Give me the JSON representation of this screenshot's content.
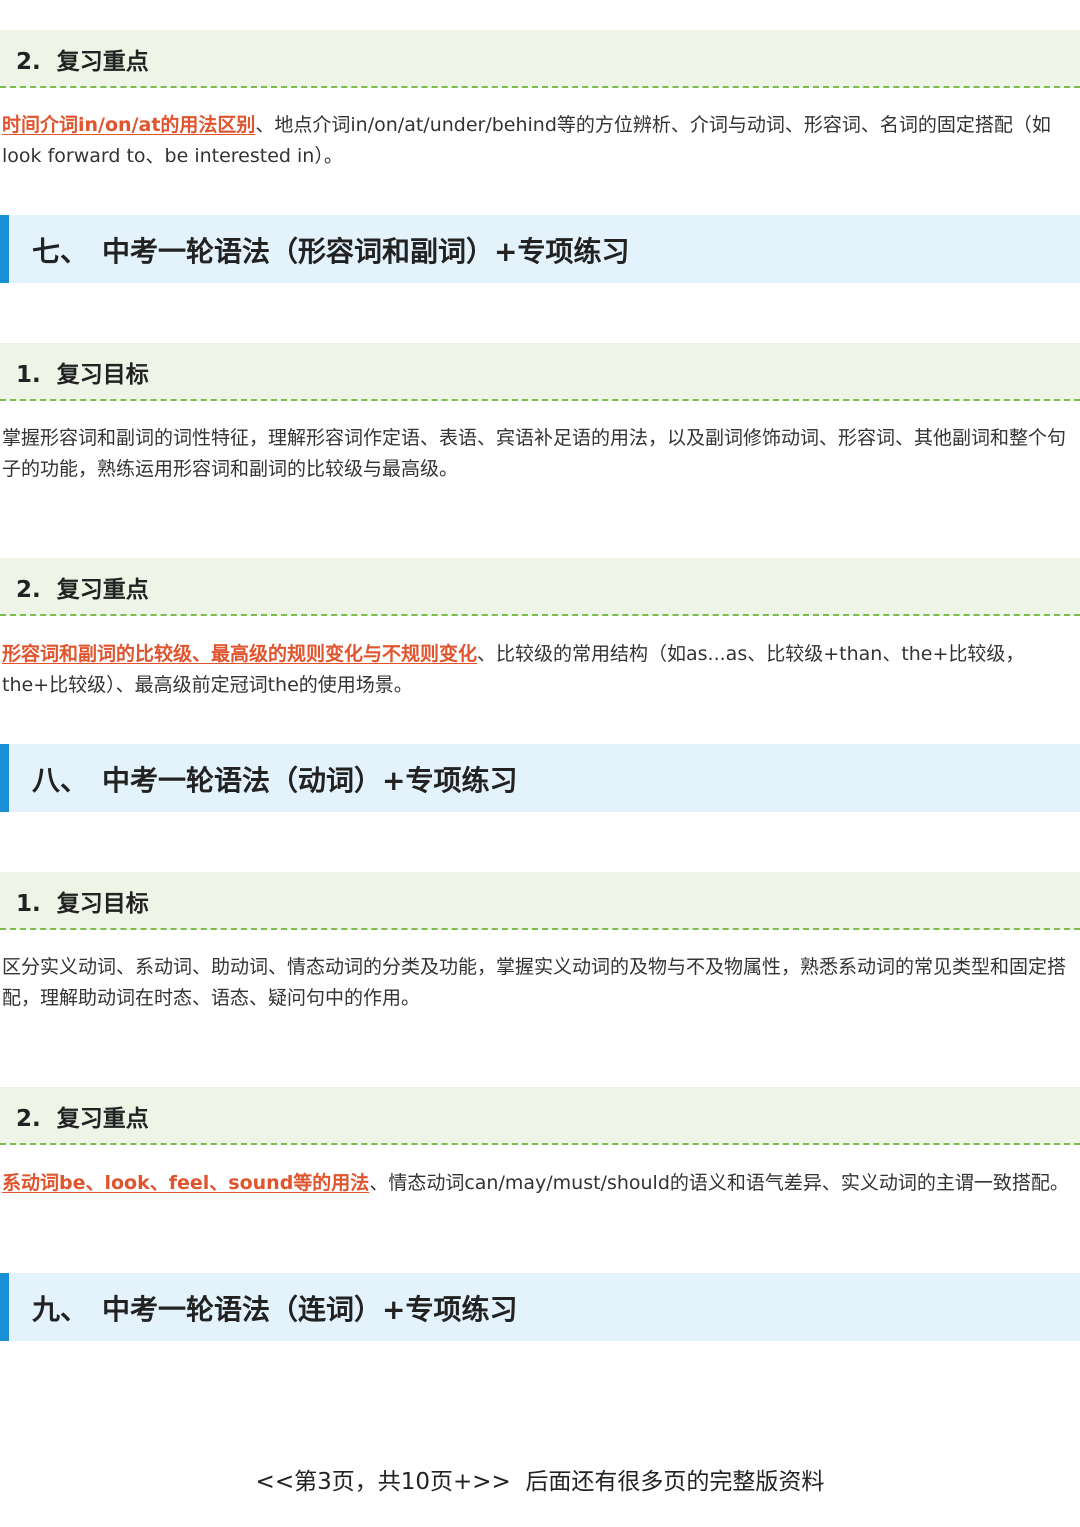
{
  "blocks": [
    {
      "sub1": {
        "number": "2.",
        "title": "复习重点"
      },
      "para1": {
        "highlight": "时间介词in/on/at的用法区别",
        "text": "、地点介词in/on/at/under/behind等的方位辨析、介词与动词、形容词、名词的固定搭配（如look forward to、be interested in）。"
      }
    }
  ],
  "sections": [
    {
      "number": "七、",
      "title": "中考一轮语法（形容词和副词）+专项练习",
      "goal_heading": {
        "number": "1.",
        "title": "复习目标"
      },
      "goal_text": "掌握形容词和副词的词性特征，理解形容词作定语、表语、宾语补足语的用法，以及副词修饰动词、形容词、其他副词和整个句子的功能，熟练运用形容词和副词的比较级与最高级。",
      "focus_heading": {
        "number": "2.",
        "title": "复习重点"
      },
      "focus_highlight": "形容词和副词的比较级、最高级的规则变化与不规则变化",
      "focus_text": "、比较级的常用结构（如as...as、比较级+than、the+比较级，the+比较级）、最高级前定冠词the的使用场景。"
    },
    {
      "number": "八、",
      "title": "中考一轮语法（动词）+专项练习",
      "goal_heading": {
        "number": "1.",
        "title": "复习目标"
      },
      "goal_text": "区分实义动词、系动词、助动词、情态动词的分类及功能，掌握实义动词的及物与不及物属性，熟悉系动词的常见类型和固定搭配，理解助动词在时态、语态、疑问句中的作用。",
      "focus_heading": {
        "number": "2.",
        "title": "复习重点"
      },
      "focus_highlight": "系动词be、look、feel、sound等的用法",
      "focus_text": "、情态动词can/may/must/should的语义和语气差异、实义动词的主谓一致搭配。"
    },
    {
      "number": "九、",
      "title": "中考一轮语法（连词）+专项练习"
    }
  ],
  "footer": {
    "text": "<<第3页，共10页+>>  后面还有很多页的完整版资料"
  },
  "colors": {
    "highlight": "#e0542e",
    "section_bar": "#1a8fd6",
    "section_bg": "#e3f2fb",
    "subhead_bg": "#eef5e6",
    "dashed_line": "#7dbb4f"
  }
}
